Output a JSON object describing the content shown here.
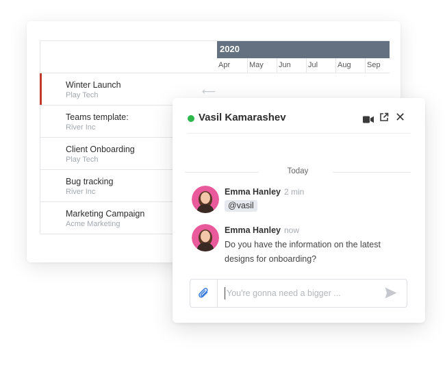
{
  "gantt": {
    "year": "2020",
    "months": [
      "Apr",
      "May",
      "Jun",
      "Jul",
      "Aug",
      "Sep"
    ],
    "rows": [
      {
        "title": "Winter Launch",
        "client": "Play Tech",
        "active": true
      },
      {
        "title": "Teams template:",
        "client": "River Inc",
        "active": false
      },
      {
        "title": "Client Onboarding",
        "client": "Play Tech",
        "active": false
      },
      {
        "title": "Bug tracking",
        "client": "River Inc",
        "active": false
      },
      {
        "title": "Marketing Campaign",
        "client": "Acme Marketing",
        "active": false
      }
    ],
    "active_color": "#c0392b",
    "year_bar_color": "#637180"
  },
  "chat": {
    "contact_name": "Vasil Kamarashev",
    "status_color": "#2eb84c",
    "divider_label": "Today",
    "messages": [
      {
        "author": "Emma Hanley",
        "time": "2 min",
        "mention": "@vasil"
      },
      {
        "author": "Emma Hanley",
        "time": "now",
        "text": "Do you have the information on the latest designs for onboarding?"
      }
    ],
    "input_placeholder": "You're gonna need a bigger ...",
    "header_icons": [
      "video-icon",
      "popout-icon",
      "close-icon"
    ],
    "close_glyph": "✕",
    "accent_color": "#3b7ddd"
  }
}
